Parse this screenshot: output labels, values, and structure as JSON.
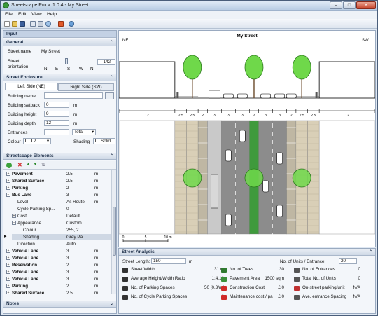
{
  "window": {
    "title": "Streetscape Pro v. 1.0.4 - My Street",
    "min": "–",
    "max": "□",
    "close": "✕"
  },
  "menu": [
    "File",
    "Edit",
    "View",
    "Help"
  ],
  "toolbar": {
    "icons": [
      "new-icon",
      "open-icon",
      "save-icon",
      "copy-icon",
      "print-icon",
      "zoom-icon",
      "stop-icon",
      "refresh-icon"
    ]
  },
  "input_panel": {
    "title": "Input",
    "general": {
      "header": "General",
      "street_name_label": "Street name",
      "street_name_value": "My Street",
      "orientation_label": "Street\norientation",
      "orientation_value": "142",
      "compass": [
        "N",
        "E",
        "S",
        "W",
        "N"
      ]
    },
    "enclosure": {
      "header": "Street Enclosure",
      "tab_left": "Left Side (NE)",
      "tab_right": "Right Side (SW)",
      "building_name_label": "Building name",
      "building_name_value": "",
      "setback_label": "Building setback",
      "setback_value": "0",
      "height_label": "Building height",
      "height_value": "9",
      "depth_label": "Building depth",
      "depth_value": "12",
      "entrances_label": "Entrances",
      "entrances_value": "",
      "entrances_mode": "Total",
      "unit_m": "m",
      "colour_label": "Colour",
      "colour_value": "2...",
      "shading_label": "Shading",
      "shading_value": "Solid"
    },
    "elements": {
      "header": "Streetscape Elements",
      "rows": [
        {
          "name": "Pavement",
          "value": "2.5",
          "unit": "m",
          "indent": 0,
          "bold": true,
          "expander": "+"
        },
        {
          "name": "Shared Surface",
          "value": "2.5",
          "unit": "m",
          "indent": 0,
          "bold": true,
          "expander": "+"
        },
        {
          "name": "Parking",
          "value": "2",
          "unit": "m",
          "indent": 0,
          "bold": true,
          "expander": "+"
        },
        {
          "name": "Bus Lane",
          "value": "3",
          "unit": "m",
          "indent": 0,
          "bold": true,
          "expander": "−"
        },
        {
          "name": "Level",
          "value": "As Route",
          "unit": "m",
          "indent": 1,
          "bold": false,
          "expander": ""
        },
        {
          "name": "Cycle Parking Sp...",
          "value": "0",
          "unit": "",
          "indent": 1,
          "bold": false,
          "expander": ""
        },
        {
          "name": "Cost",
          "value": "Default",
          "unit": "",
          "indent": 1,
          "bold": false,
          "expander": "+"
        },
        {
          "name": "Appearance",
          "value": "Custom",
          "unit": "",
          "indent": 1,
          "bold": false,
          "expander": "−"
        },
        {
          "name": "Colour",
          "value": "255, 2...",
          "unit": "",
          "indent": 2,
          "bold": false,
          "expander": ""
        },
        {
          "name": "Shading",
          "value": "Grey Pa...",
          "unit": "",
          "indent": 2,
          "bold": false,
          "expander": ""
        },
        {
          "name": "Direction",
          "value": "Auto",
          "unit": "",
          "indent": 1,
          "bold": false,
          "expander": ""
        },
        {
          "name": "Vehicle Lane",
          "value": "3",
          "unit": "m",
          "indent": 0,
          "bold": true,
          "expander": "+"
        },
        {
          "name": "Vehicle Lane",
          "value": "3",
          "unit": "m",
          "indent": 0,
          "bold": true,
          "expander": "+"
        },
        {
          "name": "Reservation",
          "value": "2",
          "unit": "m",
          "indent": 0,
          "bold": true,
          "expander": "+"
        },
        {
          "name": "Vehicle Lane",
          "value": "3",
          "unit": "m",
          "indent": 0,
          "bold": true,
          "expander": "+"
        },
        {
          "name": "Vehicle Lane",
          "value": "3",
          "unit": "m",
          "indent": 0,
          "bold": true,
          "expander": "+"
        },
        {
          "name": "Parking",
          "value": "2",
          "unit": "m",
          "indent": 0,
          "bold": true,
          "expander": "+"
        },
        {
          "name": "Shared Surface",
          "value": "2.5",
          "unit": "m",
          "indent": 0,
          "bold": true,
          "expander": "+"
        }
      ]
    },
    "notes": {
      "header": "Notes"
    }
  },
  "canvas": {
    "title": "My Street",
    "left_dir": "NE",
    "right_dir": "SW",
    "dimension_labels": [
      "12",
      "2.5",
      "2.5",
      "2",
      "3",
      "3",
      "3",
      "2",
      "3",
      "3",
      "2",
      "2.5",
      "2.5",
      "12"
    ],
    "scale_labels": [
      "0",
      "5",
      "10 m"
    ],
    "colors": {
      "building": "#c8c0b0",
      "pavement": "#d9cfb7",
      "road": "#8c8c8c",
      "reservation": "#3f9a3c",
      "bus_lane": "#c9c9c9"
    }
  },
  "analysis": {
    "header": "Street Analysis",
    "street_length_label": "Street Length:",
    "street_length_value": "150",
    "street_length_unit": "m",
    "units_label": "No. of Units / Entrance:",
    "units_value": "20",
    "col1": [
      {
        "icon": "street-width-icon",
        "label": "Street Width",
        "value": "31 m"
      },
      {
        "icon": "height-width-icon",
        "label": "Average Height/Width Ratio",
        "value": "1:4.13"
      },
      {
        "icon": "parking-icon",
        "label": "No. of Parking Spaces",
        "value": "50 [0.3/m]"
      },
      {
        "icon": "cycle-parking-icon",
        "label": "No. of Cycle Parking Spaces",
        "value": "0"
      }
    ],
    "col2": [
      {
        "icon": "trees-icon",
        "label": "No. of Trees",
        "value": "30"
      },
      {
        "icon": "pavement-area-icon",
        "label": "Pavement Area",
        "value": "1500 sqm"
      },
      {
        "icon": "construction-cost-icon",
        "label": "Construction Cost",
        "value": "£ 0"
      },
      {
        "icon": "maintenance-cost-icon",
        "label": "Maintenance cost / pa",
        "value": "£ 0"
      }
    ],
    "col3": [
      {
        "icon": "entrances-icon",
        "label": "No. of Entrances",
        "value": "0"
      },
      {
        "icon": "units-icon",
        "label": "Total No. of Units",
        "value": "0"
      },
      {
        "icon": "on-street-parking-icon",
        "label": "On-street parking/unit",
        "value": "N/A"
      },
      {
        "icon": "entrance-spacing-icon",
        "label": "Ave. entrance Spacing",
        "value": "N/A"
      }
    ]
  }
}
